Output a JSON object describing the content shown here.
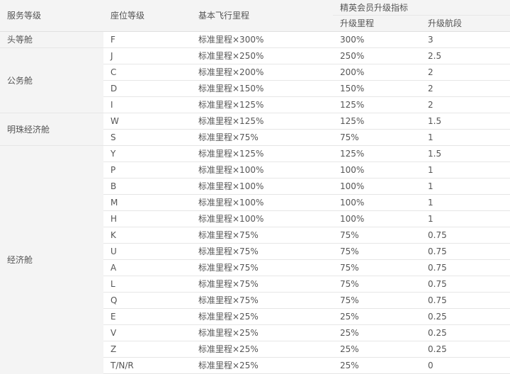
{
  "header": {
    "service_class": "服务等级",
    "seat_class": "座位等级",
    "base_mileage": "基本飞行里程",
    "elite_group": "精英会员升级指标",
    "upgrade_mileage": "升级里程",
    "upgrade_segments": "升级航段"
  },
  "groups": [
    {
      "name": "头等舱",
      "rows": [
        {
          "seat": "F",
          "base": "标准里程×300%",
          "mileage": "300%",
          "segments": "3"
        }
      ]
    },
    {
      "name": "公务舱",
      "rows": [
        {
          "seat": "J",
          "base": "标准里程×250%",
          "mileage": "250%",
          "segments": "2.5"
        },
        {
          "seat": "C",
          "base": "标准里程×200%",
          "mileage": "200%",
          "segments": "2"
        },
        {
          "seat": "D",
          "base": "标准里程×150%",
          "mileage": "150%",
          "segments": "2"
        },
        {
          "seat": "I",
          "base": "标准里程×125%",
          "mileage": "125%",
          "segments": "2"
        }
      ]
    },
    {
      "name": "明珠经济舱",
      "rows": [
        {
          "seat": "W",
          "base": "标准里程×125%",
          "mileage": "125%",
          "segments": "1.5"
        },
        {
          "seat": "S",
          "base": "标准里程×75%",
          "mileage": "75%",
          "segments": "1"
        }
      ]
    },
    {
      "name": "经济舱",
      "rows": [
        {
          "seat": "Y",
          "base": "标准里程×125%",
          "mileage": "125%",
          "segments": "1.5"
        },
        {
          "seat": "P",
          "base": "标准里程×100%",
          "mileage": "100%",
          "segments": "1"
        },
        {
          "seat": "B",
          "base": "标准里程×100%",
          "mileage": "100%",
          "segments": "1"
        },
        {
          "seat": "M",
          "base": "标准里程×100%",
          "mileage": "100%",
          "segments": "1"
        },
        {
          "seat": "H",
          "base": "标准里程×100%",
          "mileage": "100%",
          "segments": "1"
        },
        {
          "seat": "K",
          "base": "标准里程×75%",
          "mileage": "75%",
          "segments": "0.75"
        },
        {
          "seat": "U",
          "base": "标准里程×75%",
          "mileage": "75%",
          "segments": "0.75"
        },
        {
          "seat": "A",
          "base": "标准里程×75%",
          "mileage": "75%",
          "segments": "0.75"
        },
        {
          "seat": "L",
          "base": "标准里程×75%",
          "mileage": "75%",
          "segments": "0.75"
        },
        {
          "seat": "Q",
          "base": "标准里程×75%",
          "mileage": "75%",
          "segments": "0.75"
        },
        {
          "seat": "E",
          "base": "标准里程×25%",
          "mileage": "25%",
          "segments": "0.25"
        },
        {
          "seat": "V",
          "base": "标准里程×25%",
          "mileage": "25%",
          "segments": "0.25"
        },
        {
          "seat": "Z",
          "base": "标准里程×25%",
          "mileage": "25%",
          "segments": "0.25"
        },
        {
          "seat": "T/N/R",
          "base": "标准里程×25%",
          "mileage": "25%",
          "segments": "0"
        }
      ]
    }
  ]
}
